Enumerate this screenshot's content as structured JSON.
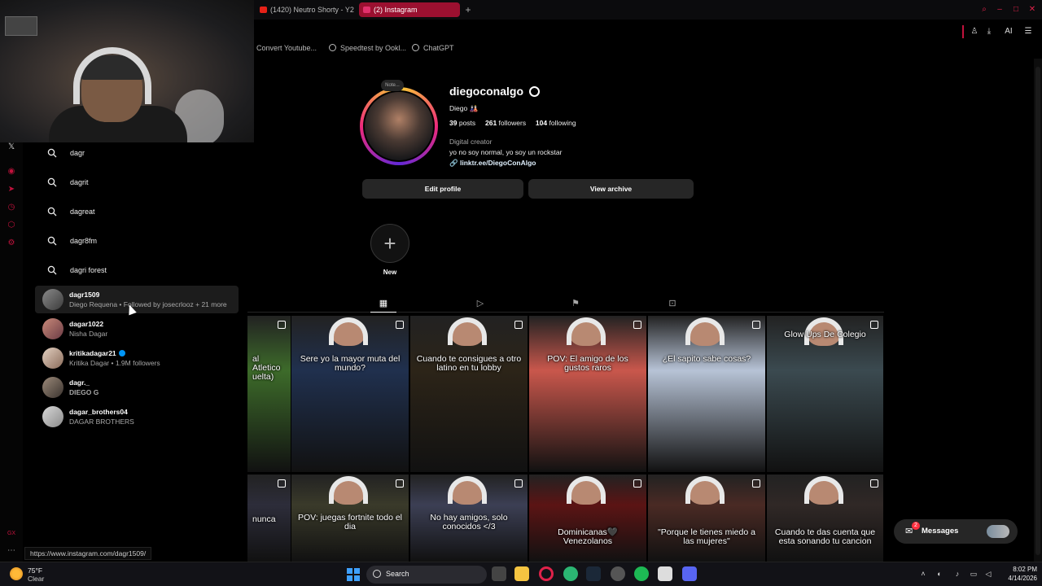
{
  "browser": {
    "tabs": [
      {
        "label": "(1420) Neutro Shorty - Y2",
        "active": false
      },
      {
        "label": "(2) Instagram",
        "active": true
      }
    ],
    "new_tab_glyph": "+",
    "bookmarks": [
      "Convert Youtube...",
      "Speedtest by Ookl...",
      "ChatGPT"
    ],
    "ai_label": "AI",
    "status_url": "https://www.instagram.com/dagr1509/",
    "accent_color": "#e0224a"
  },
  "search": {
    "suggestions": [
      "dagr",
      "dagrit",
      "dagreat",
      "dagr8fm",
      "dagri forest"
    ],
    "accounts": [
      {
        "username": "dagr1509",
        "subtitle": "Diego Requena • Followed by josecrlooz + 21 more",
        "verified": false
      },
      {
        "username": "dagar1022",
        "subtitle": "Nisha Dagar",
        "verified": false
      },
      {
        "username": "kritikadagar21",
        "subtitle": "Kritika Dagar • 1.9M followers",
        "verified": true
      },
      {
        "username": "dagr._",
        "subtitle": "DIEGO G",
        "verified": false
      },
      {
        "username": "dagar_brothers04",
        "subtitle": "DAGAR BROTHERS",
        "verified": false
      }
    ]
  },
  "profile": {
    "note": "Note...",
    "username": "diegoconalgo",
    "full_name": "Diego 🎎",
    "posts": "39",
    "posts_label": "posts",
    "followers": "261",
    "followers_label": "followers",
    "following": "104",
    "following_label": "following",
    "category": "Digital creator",
    "bio": "yo no soy normal, yo soy un rockstar",
    "link": "linktr.ee/DiegoConAlgo",
    "edit_profile": "Edit profile",
    "view_archive": "View archive",
    "new_highlight": "New",
    "new_glyph": "+"
  },
  "grid": {
    "row1": [
      {
        "caption": "al Atletico uelta)",
        "bg": "#3d6b2a"
      },
      {
        "caption": "Sere yo la mayor muta del mundo?",
        "bg": "#20304e"
      },
      {
        "caption": "Cuando te consigues a otro latino en tu lobby",
        "bg": "#2c2418"
      },
      {
        "caption": "POV: El amigo de los gustos raros",
        "bg": "#c9574c"
      },
      {
        "caption": "¿El sapito sabe cosas?",
        "bg": "#b7c3d6"
      },
      {
        "caption": "Glow Ups De Colegio",
        "bg": "#3b4a50"
      }
    ],
    "row2": [
      {
        "caption": "nunca",
        "bg": "#2d2d3a"
      },
      {
        "caption": "POV: juegas fortnite todo el dia",
        "bg": "#3a3a2a"
      },
      {
        "caption": "No hay amigos, solo conocidos </3",
        "bg": "#3c3f54"
      },
      {
        "caption": "Dominicanas🖤Venezolanos",
        "bg": "#5b1414"
      },
      {
        "caption": "\"Porque le tienes miedo a las mujeres\"",
        "bg": "#4a2a24"
      },
      {
        "caption": "Cuando te das cuenta que esta sonando tu cancion",
        "bg": "#302826"
      }
    ]
  },
  "messages": {
    "label": "Messages",
    "badge": "2"
  },
  "taskbar": {
    "temp": "75°F",
    "condition": "Clear",
    "search_label": "Search",
    "time": "8:02 PM",
    "date": "4/14/2026"
  }
}
